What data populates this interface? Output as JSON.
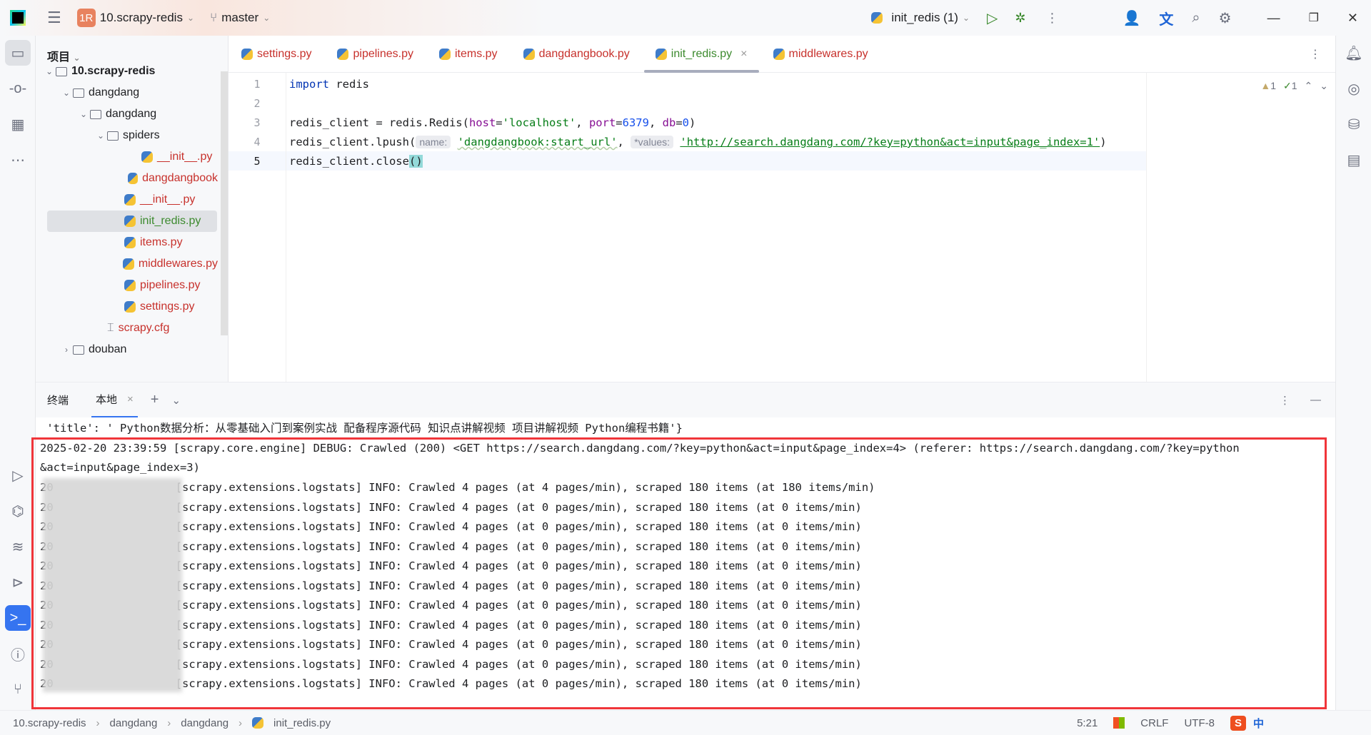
{
  "titlebar": {
    "project_badge": "1R",
    "project": "10.scrapy-redis",
    "branch": "master",
    "run_config": "init_redis (1)"
  },
  "project_panel": {
    "title": "项目",
    "tree": [
      {
        "label": "10.scrapy-redis",
        "level": 0,
        "type": "folder",
        "expanded": true,
        "bold": true
      },
      {
        "label": "dangdang",
        "level": 1,
        "type": "folder",
        "expanded": true
      },
      {
        "label": "dangdang",
        "level": 2,
        "type": "folder",
        "expanded": true
      },
      {
        "label": "spiders",
        "level": 3,
        "type": "folder",
        "expanded": true
      },
      {
        "label": "__init__.py",
        "level": 5,
        "type": "py"
      },
      {
        "label": "dangdangbook",
        "level": 5,
        "type": "py"
      },
      {
        "label": "__init__.py",
        "level": 4,
        "type": "py"
      },
      {
        "label": "init_redis.py",
        "level": 4,
        "type": "py",
        "selected": true
      },
      {
        "label": "items.py",
        "level": 4,
        "type": "py"
      },
      {
        "label": "middlewares.py",
        "level": 4,
        "type": "py"
      },
      {
        "label": "pipelines.py",
        "level": 4,
        "type": "py"
      },
      {
        "label": "settings.py",
        "level": 4,
        "type": "py"
      },
      {
        "label": "scrapy.cfg",
        "level": 3,
        "type": "cfg"
      },
      {
        "label": "douban",
        "level": 1,
        "type": "folder",
        "expanded": false
      }
    ]
  },
  "tabs": [
    {
      "label": "settings.py"
    },
    {
      "label": "pipelines.py"
    },
    {
      "label": "items.py"
    },
    {
      "label": "dangdangbook.py"
    },
    {
      "label": "init_redis.py",
      "active": true
    },
    {
      "label": "middlewares.py"
    }
  ],
  "editor": {
    "inspections": {
      "warnings": "1",
      "ok": "1"
    },
    "line_numbers": [
      "1",
      "2",
      "3",
      "4",
      "5"
    ],
    "l1": {
      "kw": "import",
      "rest": " redis"
    },
    "l3": {
      "a": "redis_client = redis.Redis(",
      "host": "host",
      "eq1": "=",
      "s1": "'localhost'",
      "c1": ", ",
      "port": "port",
      "eq2": "=",
      "n1": "6379",
      "c2": ", ",
      "db": "db",
      "eq3": "=",
      "n2": "0",
      "end": ")"
    },
    "l4": {
      "a": "redis_client.lpush(",
      "h1": "name:",
      "s1": "'dangdangbook:start_url'",
      "c": ", ",
      "h2": "*values:",
      "s2": "'http://search.dangdang.com/?key=python&act=input&page_index=1'",
      "end": ")"
    },
    "l5": {
      "a": "redis_client.close",
      "b": "()"
    }
  },
  "terminal": {
    "title": "终端",
    "tab": "本地",
    "lines": [
      " 'title': ' Python数据分析：从零基础入门到案例实战 配备程序源代码 知识点讲解视频 项目讲解视频 Python编程书籍'}",
      "2025-02-20 23:39:59 [scrapy.core.engine] DEBUG: Crawled (200) <GET https://search.dangdang.com/?key=python&act=input&page_index=4> (referer: https://search.dangdang.com/?key=python",
      "&act=input&page_index=3)"
    ],
    "log_lines": [
      "[scrapy.extensions.logstats] INFO: Crawled 4 pages (at 4 pages/min), scraped 180 items (at 180 items/min)",
      "[scrapy.extensions.logstats] INFO: Crawled 4 pages (at 0 pages/min), scraped 180 items (at 0 items/min)",
      "[scrapy.extensions.logstats] INFO: Crawled 4 pages (at 0 pages/min), scraped 180 items (at 0 items/min)",
      "[scrapy.extensions.logstats] INFO: Crawled 4 pages (at 0 pages/min), scraped 180 items (at 0 items/min)",
      "[scrapy.extensions.logstats] INFO: Crawled 4 pages (at 0 pages/min), scraped 180 items (at 0 items/min)",
      "[scrapy.extensions.logstats] INFO: Crawled 4 pages (at 0 pages/min), scraped 180 items (at 0 items/min)",
      "[scrapy.extensions.logstats] INFO: Crawled 4 pages (at 0 pages/min), scraped 180 items (at 0 items/min)",
      "[scrapy.extensions.logstats] INFO: Crawled 4 pages (at 0 pages/min), scraped 180 items (at 0 items/min)",
      "[scrapy.extensions.logstats] INFO: Crawled 4 pages (at 0 pages/min), scraped 180 items (at 0 items/min)",
      "[scrapy.extensions.logstats] INFO: Crawled 4 pages (at 0 pages/min), scraped 180 items (at 0 items/min)",
      "[scrapy.extensions.logstats] INFO: Crawled 4 pages (at 0 pages/min), scraped 180 items (at 0 items/min)"
    ],
    "log_prefix": "20"
  },
  "status": {
    "breadcrumb": [
      "10.scrapy-redis",
      "dangdang",
      "dangdang",
      "init_redis.py"
    ],
    "position": "5:21",
    "line_sep": "CRLF",
    "encoding": "UTF-8",
    "ime": "中"
  },
  "colors": {
    "highlight_box": "#f0353a",
    "string": "#067d17",
    "keyword": "#0033b3",
    "number": "#1750eb"
  }
}
